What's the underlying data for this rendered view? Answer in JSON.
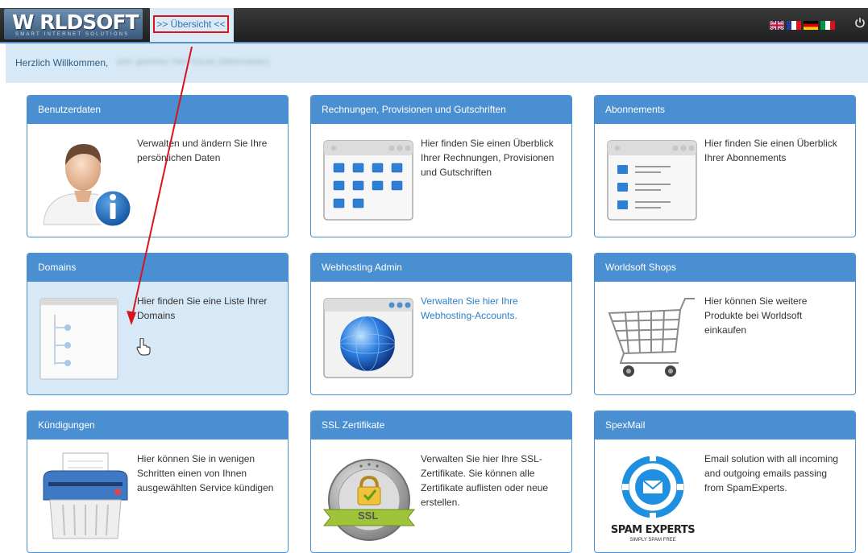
{
  "header": {
    "logo_text": "W RLDSOFT",
    "logo_subtext": "SMART INTERNET SOLUTIONS",
    "nav_tab_label": ">> Übersicht <<",
    "flags": [
      "en-flag",
      "fr-flag",
      "de-flag",
      "it-flag"
    ]
  },
  "welcome": {
    "greeting": "Herzlich Willkommen,",
    "user_name_blurred": "sehr geehrter Herr Kocas (Webmaster)"
  },
  "cards": [
    {
      "title": "Benutzerdaten",
      "text": "Verwalten und ändern Sie Ihre persönlichen Daten",
      "icon": "user-info-icon"
    },
    {
      "title": "Rechnungen, Provisionen und Gutschriften",
      "text": "Hier finden Sie einen Überblick Ihrer Rechnungen, Provisionen und Gutschriften",
      "icon": "invoices-window-icon"
    },
    {
      "title": "Abonnements",
      "text": "Hier finden Sie einen Überblick Ihrer Abonnements",
      "icon": "subscriptions-window-icon"
    },
    {
      "title": "Domains",
      "text": "Hier finden Sie eine Liste Ihrer Domains",
      "icon": "domains-tree-icon"
    },
    {
      "title": "Webhosting Admin",
      "text": "Verwalten Sie hier Ihre Webhosting-Accounts.",
      "icon": "globe-window-icon"
    },
    {
      "title": "Worldsoft Shops",
      "text": "Hier können Sie weitere Produkte bei Worldsoft einkaufen",
      "icon": "shopping-cart-icon"
    },
    {
      "title": "Kündigungen",
      "text": "Hier können Sie in wenigen Schritten einen von Ihnen ausgewählten Service kündigen",
      "icon": "shredder-icon"
    },
    {
      "title": "SSL Zertifikate",
      "text": "Verwalten Sie hier Ihre SSL-Zertifikate. Sie können alle Zertifikate auflisten oder neue erstellen.",
      "icon": "ssl-badge-icon",
      "badge_text": "SSL"
    },
    {
      "title": "SpexMail",
      "text": "Email solution with all incoming and outgoing emails passing from SpamExperts.",
      "icon": "spamexperts-logo-icon",
      "logo_text": "SPAM EXPERTS",
      "logo_tagline": "SIMPLY SPAM FREE"
    }
  ],
  "colors": {
    "accent": "#4a8fd1",
    "welcome_bg": "#d7e9f6",
    "annotation": "#d8141c"
  }
}
